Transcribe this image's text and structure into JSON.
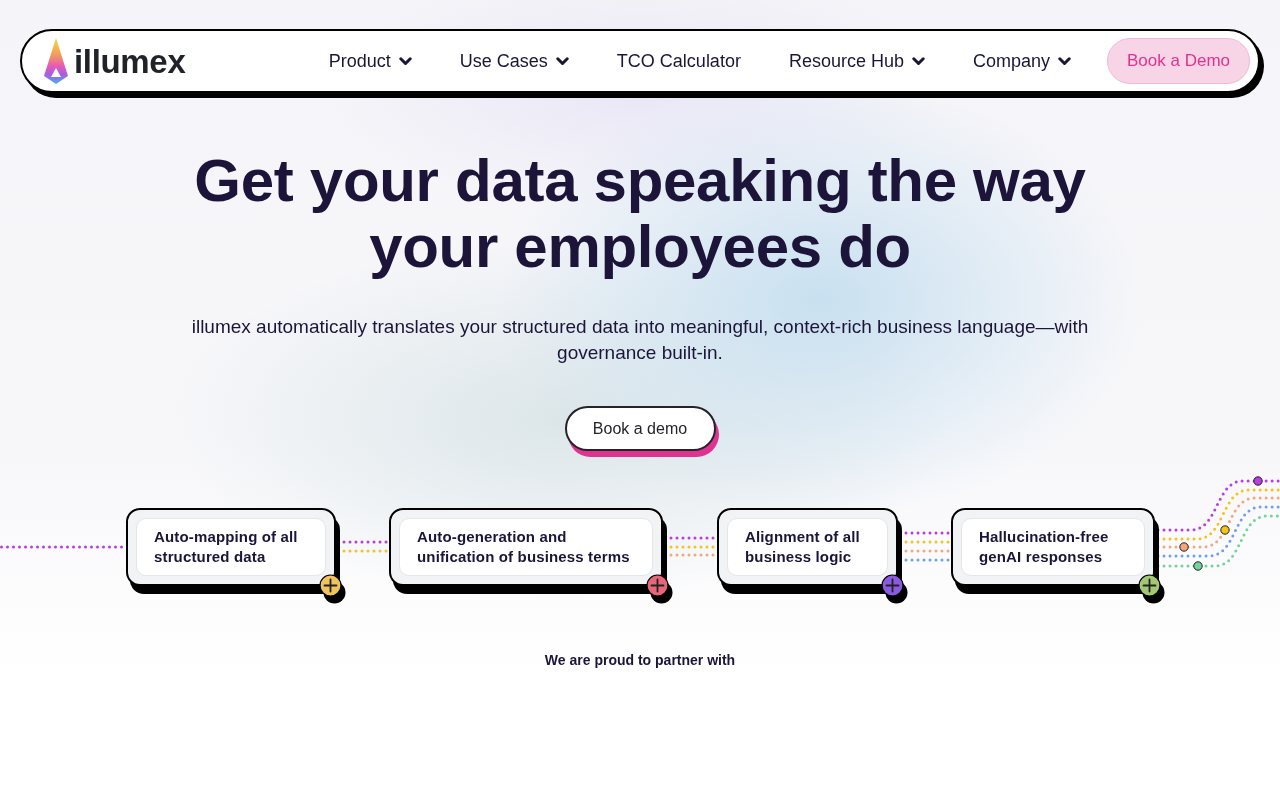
{
  "header": {
    "logo_text": "illumex",
    "nav_items": [
      {
        "label": "Product",
        "dropdown": true
      },
      {
        "label": "Use Cases",
        "dropdown": true
      },
      {
        "label": "TCO Calculator",
        "dropdown": false
      },
      {
        "label": "Resource Hub",
        "dropdown": true
      },
      {
        "label": "Company",
        "dropdown": true
      }
    ],
    "cta_button": "Book a Demo"
  },
  "hero": {
    "title": "Get your data speaking the way your employees do",
    "subtitle": "illumex automatically translates your structured data into meaningful, context-rich business language—with governance built-in.",
    "button": "Book a demo"
  },
  "steps": [
    {
      "label": "Auto-mapping of all structured data",
      "color": "#f0c35c"
    },
    {
      "label": "Auto-generation and unification of business terms",
      "color": "#e8667a"
    },
    {
      "label": "Alignment of all business logic",
      "color": "#8a5ae0"
    },
    {
      "label": "Hallucination-free genAI responses",
      "color": "#a3c873"
    }
  ],
  "partners": {
    "heading": "We are proud to partner with"
  }
}
